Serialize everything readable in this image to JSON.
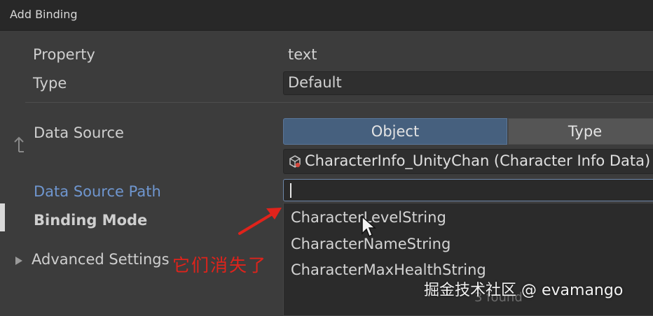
{
  "window": {
    "title": "Add Binding"
  },
  "form": {
    "property_label": "Property",
    "property_value": "text",
    "type_label": "Type",
    "type_value": "Default",
    "data_source_label": "Data Source",
    "data_source_segments": [
      "Object",
      "Type"
    ],
    "data_source_selected": "Object",
    "data_source_object": "CharacterInfo_UnityChan (Character Info Data)",
    "data_source_path_label": "Data Source Path",
    "data_source_path_value": "",
    "binding_mode_label": "Binding Mode",
    "advanced_settings_label": "Advanced Settings"
  },
  "dropdown": {
    "items": [
      "CharacterLevelString",
      "CharacterNameString",
      "CharacterMaxHealthString"
    ],
    "found_text": "3 found"
  },
  "annotation": {
    "text": "它们消失了"
  },
  "watermark": {
    "text": "掘金技术社区 @ evamango"
  },
  "colors": {
    "background": "#3c3c3c",
    "titlebar": "#282828",
    "accent_label": "#6f96cf",
    "segment_active": "#46607e",
    "annotation_red": "#e0231b"
  },
  "icons": {
    "data_source_link": "link-arrow-icon",
    "object_field": "scriptable-object-icon",
    "advanced_settings": "triangle-right-icon",
    "mouse_pointer": "cursor-arrow-icon",
    "annotation_arrow": "red-arrow-icon"
  }
}
